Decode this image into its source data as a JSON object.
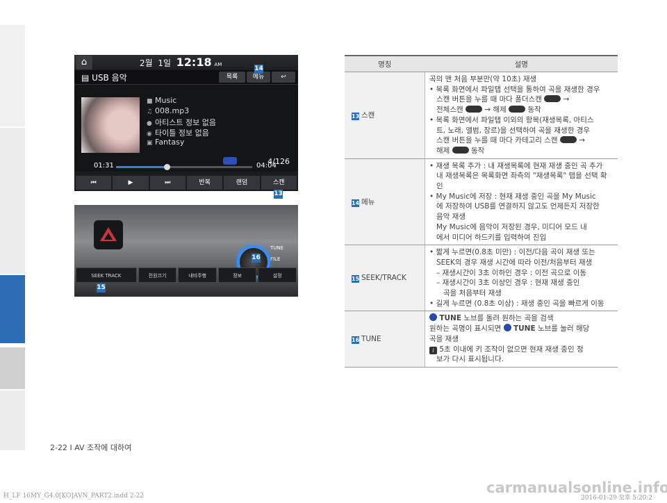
{
  "screen": {
    "home_icon": "home-icon",
    "clock_month": "2월",
    "clock_day": "1일",
    "clock_time": "12:18",
    "clock_ampm": "AM",
    "title": "USB 음악",
    "btn_list": "목록",
    "btn_menu": "메뉴",
    "btn_back": "↩",
    "track_folder": "Music",
    "track_file": "008.mp3",
    "track_artist": "아티스트 정보 없음",
    "track_title": "타이틀 정보 없음",
    "track_genre": "Fantasy",
    "track_count": "4/126",
    "time_elapsed": "01:31",
    "time_total": "04:04",
    "progress_fraction": 0.37,
    "ctrl_prev": "⏮",
    "ctrl_play": "▶",
    "ctrl_next": "⏭",
    "ctrl_repeat": "반복",
    "ctrl_random": "랜덤",
    "ctrl_scan": "스캔"
  },
  "panel": {
    "tune_label": "TUNE",
    "file_label": "FILE",
    "seek_label": "SEEK\nTRACK",
    "btn_power": "전원끄기",
    "btn_myhome": "내비주행",
    "btn_info": "정보",
    "btn_setup": "설정"
  },
  "callouts": {
    "n13": "13",
    "n14": "14",
    "n15": "15",
    "n16": "16"
  },
  "table": {
    "header_name": "명칭",
    "header_desc": "설명",
    "rows": [
      {
        "num": "13",
        "name": "스캔",
        "lines": [
          "곡의 맨 처음 부분만(약 10초) 재생",
          "• 목록 화면에서 파일탭 선택을 통하여 곡을 재생한 경우",
          "스캔 버튼을 누를 때 마다 폴더스캔",
          "전체스캔",
          "해제",
          "동작",
          "• 목록 화면에서 파일탭 이외의 항목(재생목록, 아티스",
          "트, 노래, 앨범, 장르)을 선택하여 곡을 재생한 경우",
          "스캔 버튼을 누를 때 마다 카테고리 스캔",
          "해제",
          "동작"
        ]
      },
      {
        "num": "14",
        "name": "메뉴",
        "lines": [
          "• 재생 목록 추가 : 내 재생목록에 현재 재생 중인 곡 추가",
          "내 재생목록은 목록화면 좌측의 \"재생목록\" 탭을 선택 확인",
          "• My Music에 저장 : 현재 재생 중인 곡을 My Music",
          "에 저장하여 USB를 연결하지 않고도 언제든지 저장한",
          "음악 재생",
          "My Music에 음악이 저장된 경우, 미디어 모드 내",
          "에서 미디어 하드키를 입력하여 진입"
        ]
      },
      {
        "num": "15",
        "name": "SEEK/TRACK",
        "lines": [
          "• 짧게 누르면(0.8초 미만) : 이전/다음 곡이 재생 또는",
          "SEEK의 경우 재생 시간에 따라 이전/처음부터 재생",
          "– 재생시간이 3초 이하인 경우 : 이전 곡으로 이동",
          "– 재생시간이 3초 이상인 경우 : 현재 재생 중인",
          "곡을 처음부터 재생",
          "• 길게 누르면 (0.8초 이상) : 재생 중인 곡을 빠르게 이동"
        ]
      },
      {
        "num": "16",
        "name": "TUNE",
        "lines": [
          "TUNE",
          "노브를 돌려 원하는 곡을 검색",
          "원하는 곡명이 표시되면",
          "TUNE",
          "노브를 눌러 해당",
          "곡을 재생",
          "5초 이내에 키 조작이 없으면 현재 재생 중인 정",
          "보가 다시 표시됩니다."
        ]
      }
    ]
  },
  "footer": "2-22 I AV 조작에 대하여",
  "print_left": "H_LF 16MY_G4.0[KO]AVN_PART2.indd   2-22",
  "print_right": "2016-01-29   오후 5:20:2",
  "watermark": "carmanualsonline.info",
  "colors": {
    "accent": "#2d6db4",
    "scan_blue": "#3a7be0"
  }
}
